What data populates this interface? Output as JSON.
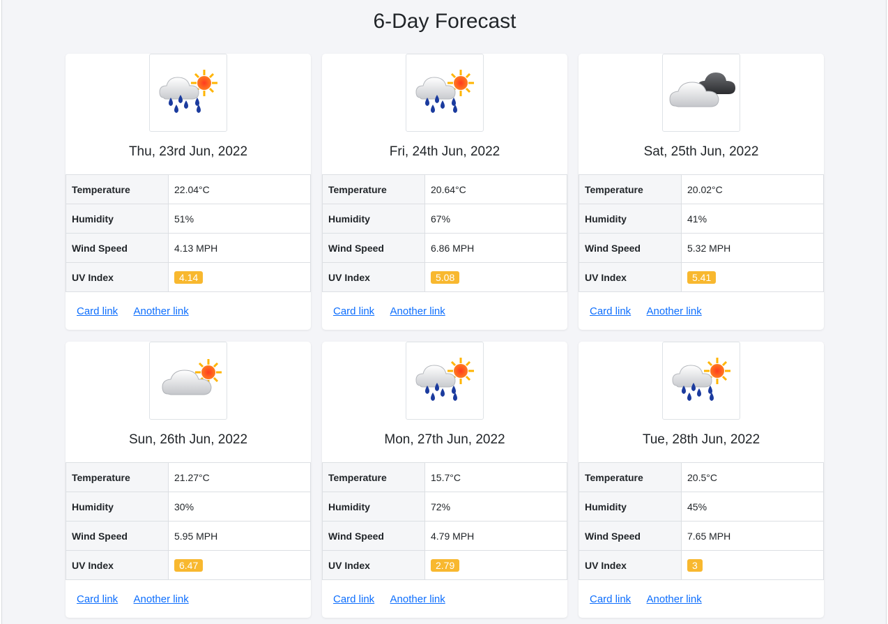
{
  "page": {
    "title": "6-Day Forecast"
  },
  "colors": {
    "uv_badge": "#f8b82f",
    "link": "#0d6efd",
    "background": "#f4f5f8"
  },
  "labels": {
    "temperature": "Temperature",
    "humidity": "Humidity",
    "wind_speed": "Wind Speed",
    "uv_index": "UV Index",
    "card_link": "Card link",
    "another_link": "Another link"
  },
  "days": [
    {
      "date": "Thu, 23rd Jun, 2022",
      "icon": "rain-sun-icon",
      "temperature": "22.04°C",
      "humidity": "51%",
      "wind_speed": "4.13 MPH",
      "uv_index": "4.14"
    },
    {
      "date": "Fri, 24th Jun, 2022",
      "icon": "rain-sun-icon",
      "temperature": "20.64°C",
      "humidity": "67%",
      "wind_speed": "6.86 MPH",
      "uv_index": "5.08"
    },
    {
      "date": "Sat, 25th Jun, 2022",
      "icon": "dark-cloud-icon",
      "temperature": "20.02°C",
      "humidity": "41%",
      "wind_speed": "5.32 MPH",
      "uv_index": "5.41"
    },
    {
      "date": "Sun, 26th Jun, 2022",
      "icon": "cloud-sun-icon",
      "temperature": "21.27°C",
      "humidity": "30%",
      "wind_speed": "5.95 MPH",
      "uv_index": "6.47"
    },
    {
      "date": "Mon, 27th Jun, 2022",
      "icon": "rain-sun-icon",
      "temperature": "15.7°C",
      "humidity": "72%",
      "wind_speed": "4.79 MPH",
      "uv_index": "2.79"
    },
    {
      "date": "Tue, 28th Jun, 2022",
      "icon": "rain-sun-icon",
      "temperature": "20.5°C",
      "humidity": "45%",
      "wind_speed": "7.65 MPH",
      "uv_index": "3"
    }
  ]
}
